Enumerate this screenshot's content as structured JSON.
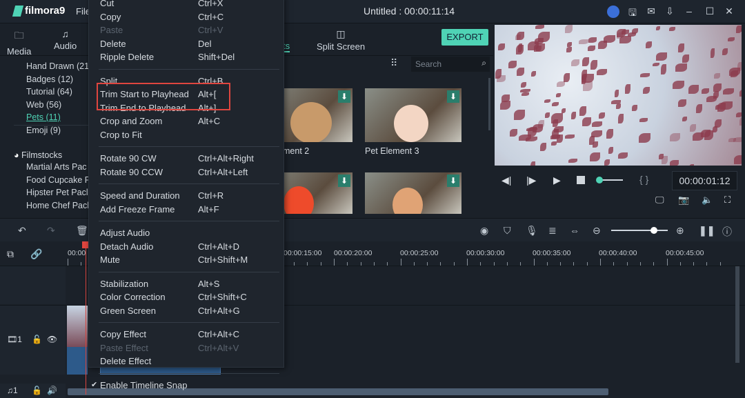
{
  "app": {
    "logo": "filmora9",
    "menu_file": "File",
    "title": "Untitled : 00:00:11:14"
  },
  "tabs": [
    {
      "label": "Media",
      "icon": "folder-icon"
    },
    {
      "label": "Audio",
      "icon": "music-icon"
    },
    {
      "label": "ts",
      "icon": ""
    },
    {
      "label": "Split Screen",
      "icon": "split-screen-icon"
    }
  ],
  "export_label": "EXPORT",
  "search": {
    "placeholder": "Search"
  },
  "categories": [
    "Hand Drawn (21",
    "Badges (12)",
    "Tutorial (64)",
    "Web (56)",
    "Pets (11)",
    "Emoji (9)"
  ],
  "selected_category": "Pets (11)",
  "filmstocks": {
    "label": "Filmstocks",
    "items": [
      "Martial Arts Pac",
      "Food Cupcake P",
      "Hipster Pet Pacl",
      "Home Chef Pacl"
    ]
  },
  "elements": [
    {
      "label": "ment 2"
    },
    {
      "label": "Pet Element 3"
    },
    {
      "label": ""
    },
    {
      "label": ""
    }
  ],
  "player": {
    "timecode": "00:00:01:12",
    "progress": 0.05,
    "brackets": "{ }"
  },
  "context_menu": [
    {
      "label": "Cut",
      "shortcut": "Ctrl+X"
    },
    {
      "label": "Copy",
      "shortcut": "Ctrl+C"
    },
    {
      "label": "Paste",
      "shortcut": "Ctrl+V",
      "disabled": true
    },
    {
      "label": "Delete",
      "shortcut": "Del"
    },
    {
      "label": "Ripple Delete",
      "shortcut": "Shift+Del"
    },
    {
      "sep": true
    },
    {
      "label": "Split",
      "shortcut": "Ctrl+B"
    },
    {
      "label": "Trim Start to Playhead",
      "shortcut": "Alt+["
    },
    {
      "label": "Trim End to Playhead",
      "shortcut": "Alt+]"
    },
    {
      "label": "Crop and Zoom",
      "shortcut": "Alt+C"
    },
    {
      "label": "Crop to Fit",
      "shortcut": ""
    },
    {
      "sep": true
    },
    {
      "label": "Rotate 90 CW",
      "shortcut": "Ctrl+Alt+Right"
    },
    {
      "label": "Rotate 90 CCW",
      "shortcut": "Ctrl+Alt+Left"
    },
    {
      "sep": true
    },
    {
      "label": "Speed and Duration",
      "shortcut": "Ctrl+R"
    },
    {
      "label": "Add Freeze Frame",
      "shortcut": "Alt+F"
    },
    {
      "sep": true
    },
    {
      "label": "Adjust Audio",
      "shortcut": ""
    },
    {
      "label": "Detach Audio",
      "shortcut": "Ctrl+Alt+D"
    },
    {
      "label": "Mute",
      "shortcut": "Ctrl+Shift+M"
    },
    {
      "sep": true
    },
    {
      "label": "Stabilization",
      "shortcut": "Alt+S"
    },
    {
      "label": "Color Correction",
      "shortcut": "Ctrl+Shift+C"
    },
    {
      "label": "Green Screen",
      "shortcut": "Ctrl+Alt+G"
    },
    {
      "sep": true
    },
    {
      "label": "Copy Effect",
      "shortcut": "Ctrl+Alt+C"
    },
    {
      "label": "Paste Effect",
      "shortcut": "Ctrl+Alt+V",
      "disabled": true
    },
    {
      "label": "Delete Effect",
      "shortcut": ""
    },
    {
      "sep": true
    },
    {
      "label": "Enable Timeline Snap",
      "shortcut": "",
      "checked": true
    }
  ],
  "ruler": [
    "00:00",
    "00:00:15:00",
    "00:00:20:00",
    "00:00:25:00",
    "00:00:30:00",
    "00:00:35:00",
    "00:00:40:00",
    "00:00:45:00"
  ],
  "tracks": {
    "video": "1",
    "audio": "1"
  },
  "zoom_level": 0.75,
  "colors": {
    "accent": "#4fd3b5",
    "highlight_box": "#e0463f",
    "playhead": "#e0463f"
  }
}
